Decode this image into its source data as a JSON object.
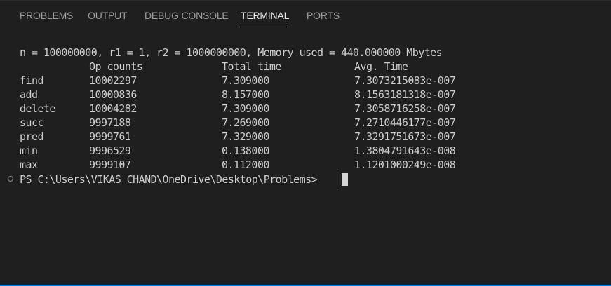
{
  "tabs": {
    "problems": "PROBLEMS",
    "output": "OUTPUT",
    "debug_console": "DEBUG CONSOLE",
    "terminal": "TERMINAL",
    "ports": "PORTS"
  },
  "terminal": {
    "summary": "n = 100000000, r1 = 1, r2 = 1000000000, Memory used = 440.000000 Mbytes",
    "headers": {
      "op_counts": "Op counts",
      "total_time": "Total time",
      "avg_time": "Avg. Time"
    },
    "rows": [
      {
        "op": "find",
        "count": "10002297",
        "total": "7.309000",
        "avg": "7.3073215083e-007"
      },
      {
        "op": "add",
        "count": "10000836",
        "total": "8.157000",
        "avg": "8.1563181318e-007"
      },
      {
        "op": "delete",
        "count": "10004282",
        "total": "7.309000",
        "avg": "7.3058716258e-007"
      },
      {
        "op": "succ",
        "count": "9997188",
        "total": "7.269000",
        "avg": "7.2710446177e-007"
      },
      {
        "op": "pred",
        "count": "9999761",
        "total": "7.329000",
        "avg": "7.3291751673e-007"
      },
      {
        "op": "min",
        "count": "9996529",
        "total": "0.138000",
        "avg": "1.3804791643e-008"
      },
      {
        "op": "max",
        "count": "9999107",
        "total": "0.112000",
        "avg": "1.1201000249e-008"
      }
    ],
    "prompt": "PS C:\\Users\\VIKAS CHAND\\OneDrive\\Desktop\\Problems> "
  },
  "colors": {
    "background": "#1f1f1f",
    "text": "#cccccc",
    "inactive_tab": "#9d9d9d",
    "active_tab": "#e7e7e7",
    "accent": "#0b7ad1"
  }
}
